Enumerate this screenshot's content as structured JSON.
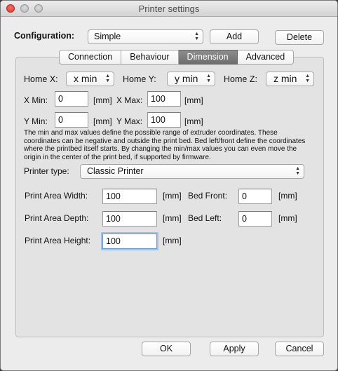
{
  "window": {
    "title": "Printer settings"
  },
  "configuration": {
    "label": "Configuration:",
    "selected": "Simple",
    "add_label": "Add",
    "delete_label": "Delete"
  },
  "tabs": [
    {
      "label": "Connection",
      "active": false
    },
    {
      "label": "Behaviour",
      "active": false
    },
    {
      "label": "Dimension",
      "active": true
    },
    {
      "label": "Advanced",
      "active": false
    }
  ],
  "home": {
    "x_label": "Home X:",
    "x_value": "x min",
    "y_label": "Home Y:",
    "y_value": "y min",
    "z_label": "Home Z:",
    "z_value": "z min"
  },
  "limits": {
    "x_min_label": "X Min:",
    "x_min": "0",
    "x_max_label": "X Max:",
    "x_max": "100",
    "y_min_label": "Y Min:",
    "y_min": "0",
    "y_max_label": "Y Max:",
    "y_max": "100",
    "unit": "[mm]"
  },
  "description": "The min and max values define the possible range of extruder coordinates. These coordinates can be negative and outside the print bed. Bed left/front define the coordinates where the printbed itself starts. By changing the min/max values you can even move the origin in the center of the print bed, if supported by firmware.",
  "printer_type": {
    "label": "Printer type:",
    "selected": "Classic Printer"
  },
  "print_area": {
    "width_label": "Print Area Width:",
    "width": "100",
    "depth_label": "Print Area Depth:",
    "depth": "100",
    "height_label": "Print Area Height:",
    "height": "100",
    "bed_front_label": "Bed Front:",
    "bed_front": "0",
    "bed_left_label": "Bed Left:",
    "bed_left": "0",
    "unit": "[mm]"
  },
  "footer": {
    "ok_label": "OK",
    "apply_label": "Apply",
    "cancel_label": "Cancel"
  }
}
